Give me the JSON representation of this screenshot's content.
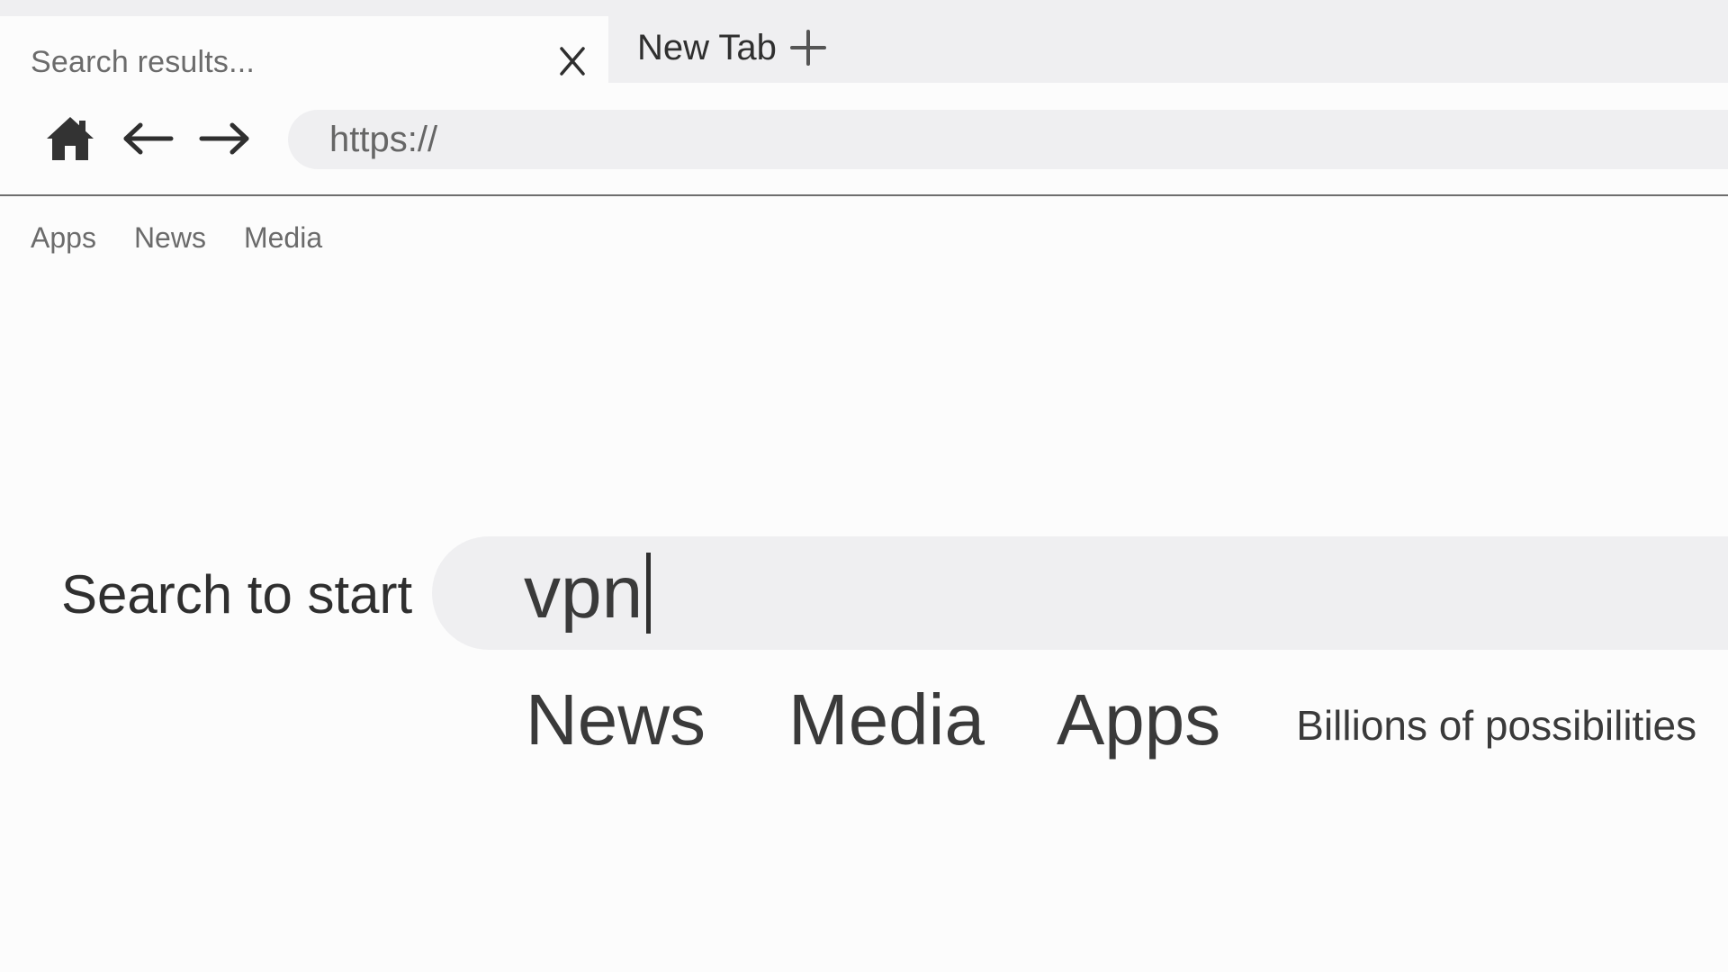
{
  "browser": {
    "active_tab": {
      "title": "Search results...",
      "close_glyph": "X"
    },
    "new_tab": {
      "label": "New Tab",
      "icon": "plus-icon"
    },
    "toolbar": {
      "home_icon": "home-icon",
      "back_icon": "arrow-left-icon",
      "forward_icon": "arrow-right-icon",
      "url_value": "https://"
    }
  },
  "bookmarks": [
    {
      "label": "Apps"
    },
    {
      "label": "News"
    },
    {
      "label": "Media"
    }
  ],
  "search": {
    "label": "Search to start",
    "value": "vpn"
  },
  "quick_links": [
    {
      "label": "News"
    },
    {
      "label": "Media"
    },
    {
      "label": "Apps"
    }
  ],
  "tagline": "Billions of possibilities",
  "colors": {
    "background": "#fcfcfc",
    "chrome_gray": "#efeff1",
    "text_dark": "#2f2f2f",
    "text_muted": "#6b6b6b"
  }
}
